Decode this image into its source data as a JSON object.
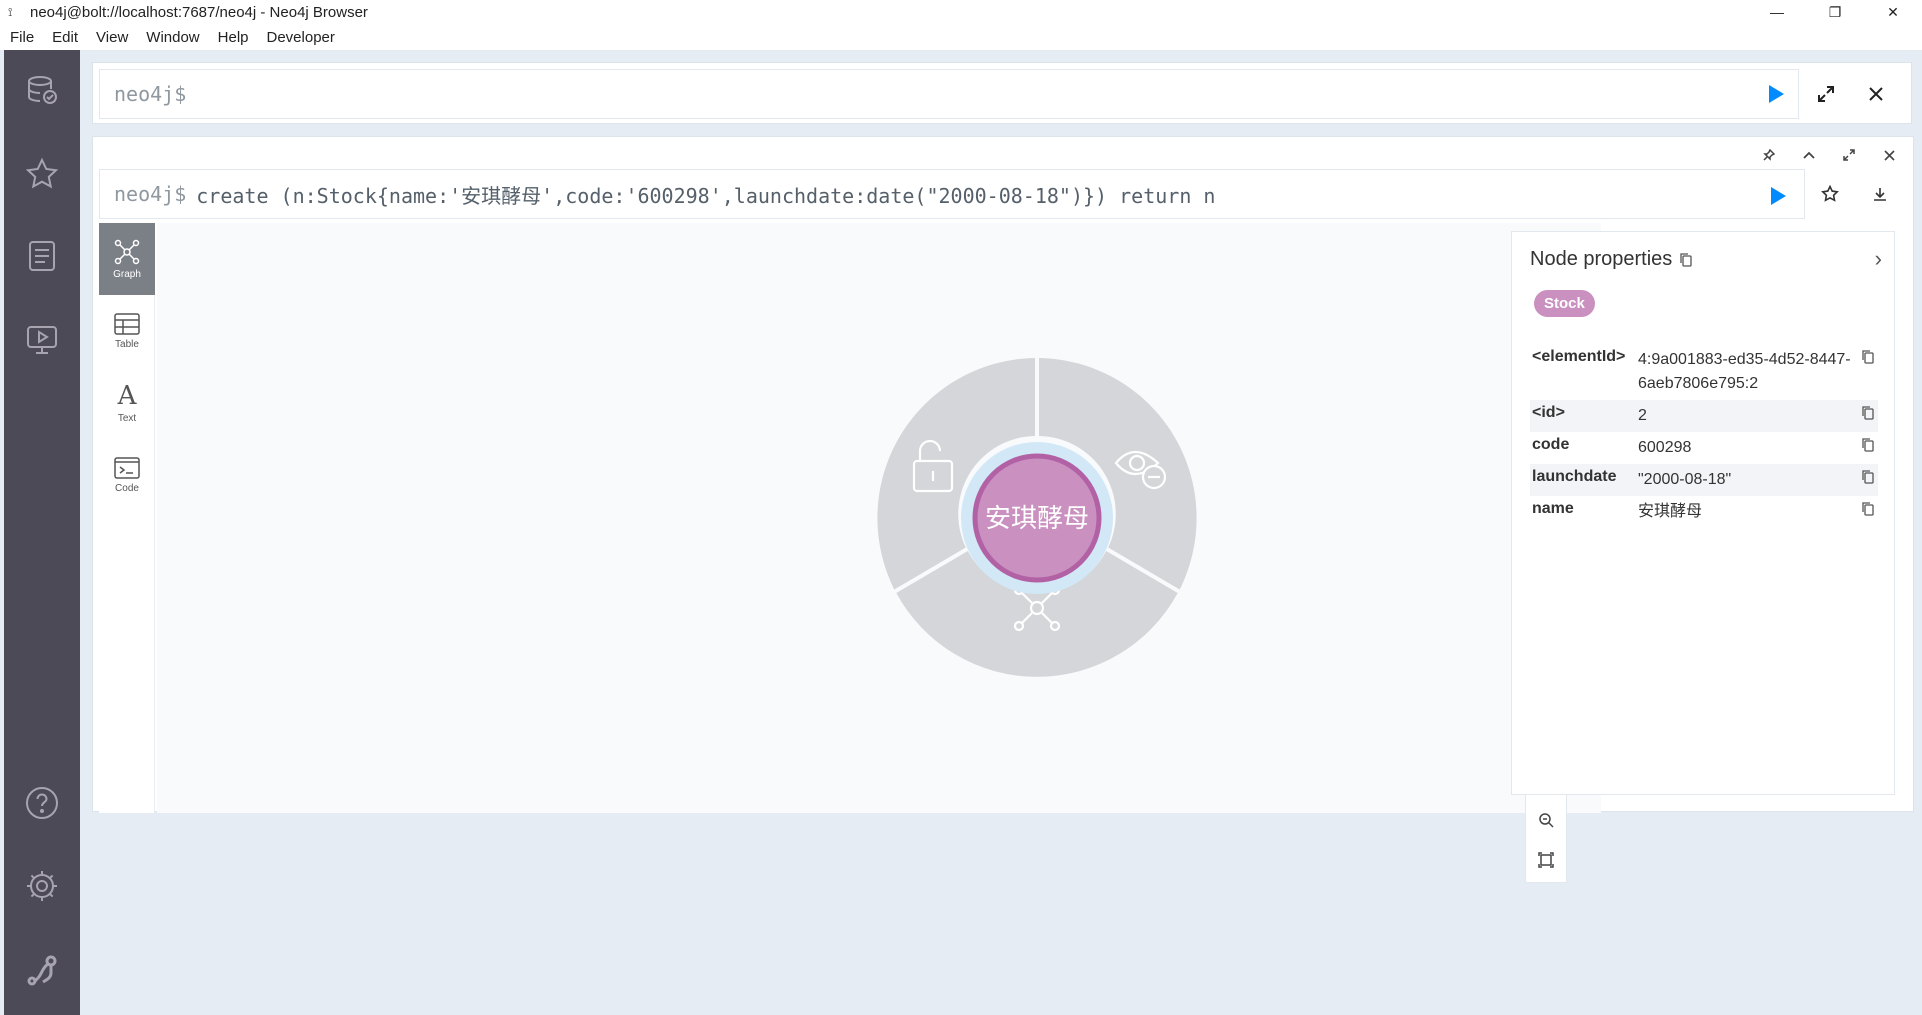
{
  "window": {
    "title": "neo4j@bolt://localhost:7687/neo4j - Neo4j Browser",
    "controls": [
      "minimize",
      "restore",
      "close"
    ]
  },
  "menu": [
    "File",
    "Edit",
    "View",
    "Window",
    "Help",
    "Developer"
  ],
  "sidebar": {
    "icons": [
      "database-icon",
      "star-icon",
      "document-icon",
      "play-monitor-icon",
      "help-icon",
      "settings-icon",
      "neo4j-logo-icon"
    ]
  },
  "editor": {
    "prompt": "neo4j$"
  },
  "frame": {
    "prompt": "neo4j$",
    "query": "create (n:Stock{name:'安琪酵母',code:'600298',launchdate:date(\"2000-08-18\")}) return n",
    "view_tabs": [
      {
        "label": "Graph",
        "active": true
      },
      {
        "label": "Table",
        "active": false
      },
      {
        "label": "Text",
        "active": false
      },
      {
        "label": "Code",
        "active": false
      }
    ],
    "node": {
      "caption": "安琪酵母",
      "color": "#c990c0",
      "border_color": "#b261a5",
      "ring_color": "#d2e8f7"
    }
  },
  "properties": {
    "title": "Node properties",
    "label": "Stock",
    "rows": [
      {
        "key": "<elementId>",
        "value": "4:9a001883-ed35-4d52-8447-6aeb7806e795:2"
      },
      {
        "key": "<id>",
        "value": "2"
      },
      {
        "key": "code",
        "value": "600298"
      },
      {
        "key": "launchdate",
        "value": "\"2000-08-18\""
      },
      {
        "key": "name",
        "value": "安琪酵母"
      }
    ]
  },
  "colors": {
    "accent": "#018bff",
    "sidebar": "#4d4a57",
    "background": "#e6ecf4"
  }
}
